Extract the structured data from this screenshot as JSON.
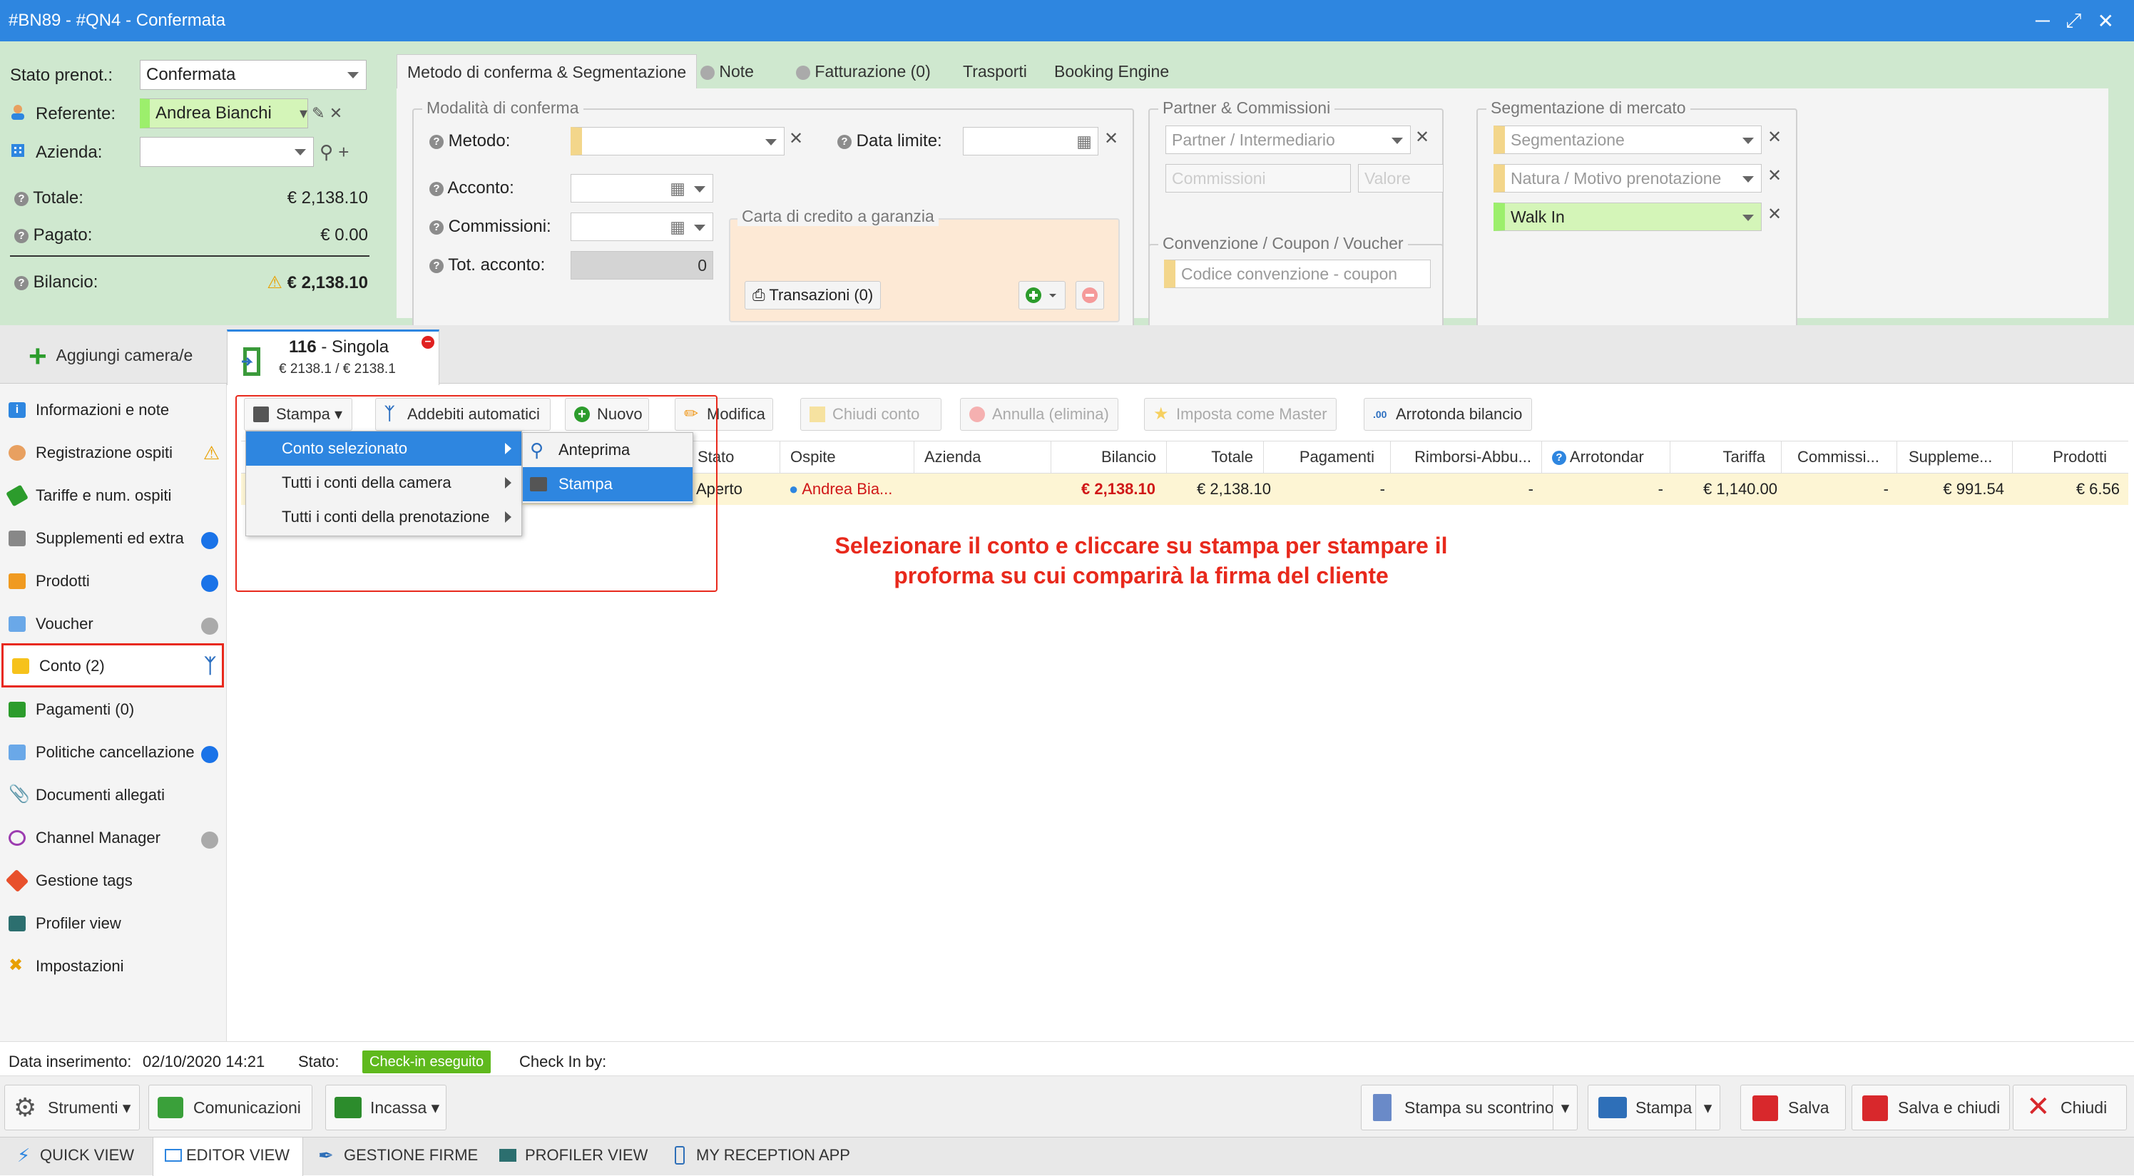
{
  "window": {
    "title": "#BN89 - #QN4 - Confermata"
  },
  "left_form": {
    "stato_label": "Stato prenot.:",
    "stato_value": "Confermata",
    "referente_label": "Referente:",
    "referente_value": "Andrea Bianchi",
    "azienda_label": "Azienda:",
    "totale_label": "Totale:",
    "totale_value": "€ 2,138.10",
    "pagato_label": "Pagato:",
    "pagato_value": "€ 0.00",
    "bilancio_label": "Bilancio:",
    "bilancio_value": "€ 2,138.10"
  },
  "top_tabs": [
    "Metodo di conferma & Segmentazione",
    "Note",
    "Fatturazione (0)",
    "Trasporti",
    "Booking Engine"
  ],
  "conferma": {
    "legend": "Modalità di conferma",
    "metodo_label": "Metodo:",
    "data_limite_label": "Data limite:",
    "acconto_label": "Acconto:",
    "commissioni_label": "Commissioni:",
    "tot_acconto_label": "Tot. acconto:",
    "tot_acconto_value": "0",
    "carta_legend": "Carta di credito a garanzia",
    "transazioni_label": "Transazioni (0)"
  },
  "partner": {
    "legend": "Partner & Commissioni",
    "partner_placeholder": "Partner / Intermediario",
    "commissioni_placeholder": "Commissioni",
    "valore_placeholder": "Valore"
  },
  "convenzione": {
    "legend": "Convenzione / Coupon / Voucher",
    "placeholder": "Codice convenzione - coupon"
  },
  "segmentazione": {
    "legend": "Segmentazione di mercato",
    "seg_placeholder": "Segmentazione",
    "natura_placeholder": "Natura / Motivo prenotazione",
    "value": "Walk In"
  },
  "add_room": "Aggiungi camera/e",
  "room_tab": {
    "number": "116",
    "type": " - Singola",
    "amount": "€ 2138.1 / € 2138.1"
  },
  "sidebar": [
    {
      "label": "Informazioni e note"
    },
    {
      "label": "Registrazione ospiti"
    },
    {
      "label": "Tariffe e num. ospiti"
    },
    {
      "label": "Supplementi ed extra"
    },
    {
      "label": "Prodotti"
    },
    {
      "label": "Voucher"
    },
    {
      "label": "Conto (2)"
    },
    {
      "label": "Pagamenti (0)"
    },
    {
      "label": "Politiche cancellazione"
    },
    {
      "label": "Documenti allegati"
    },
    {
      "label": "Channel Manager"
    },
    {
      "label": "Gestione tags"
    },
    {
      "label": "Profiler view"
    },
    {
      "label": "Impostazioni"
    }
  ],
  "toolbar": {
    "stampa": "Stampa",
    "addebiti": "Addebiti automatici",
    "nuovo": "Nuovo",
    "modifica": "Modifica",
    "chiudi": "Chiudi conto",
    "annulla": "Annulla (elimina)",
    "master": "Imposta come Master",
    "arrotonda": "Arrotonda bilancio"
  },
  "table": {
    "headers": [
      "Stato",
      "Ospite",
      "Azienda",
      "Bilancio",
      "Totale",
      "Pagamenti",
      "Rimborsi-Abbu...",
      "Arrotondar",
      "Tariffa",
      "Commissi...",
      "Suppleme...",
      "Prodotti"
    ],
    "row": [
      "Aperto",
      "Andrea Bia...",
      "",
      "€ 2,138.10",
      "€ 2,138.10",
      "-",
      "-",
      "-",
      "€ 1,140.00",
      "-",
      "€ 991.54",
      "€ 6.56"
    ]
  },
  "menu": {
    "items": [
      "Conto selezionato",
      "Tutti i conti della camera",
      "Tutti i conti della prenotazione"
    ],
    "sub": [
      "Anteprima",
      "Stampa"
    ]
  },
  "annotation": {
    "line1": "Selezionare il conto e cliccare su stampa per stampare il",
    "line2": "proforma su cui comparirà la firma del cliente"
  },
  "status": {
    "inserimento_label": "Data inserimento:",
    "inserimento_value": "02/10/2020 14:21",
    "stato_label": "Stato:",
    "stato_value": "Check-in eseguito",
    "checkin_label": "Check In by:"
  },
  "bottom": {
    "strumenti": "Strumenti",
    "comunicazioni": "Comunicazioni",
    "incassa": "Incassa",
    "scontrino": "Stampa su scontrino",
    "stampa": "Stampa",
    "salva": "Salva",
    "salva_chiudi": "Salva e chiudi",
    "chiudi": "Chiudi"
  },
  "views": [
    "QUICK VIEW",
    "EDITOR VIEW",
    "GESTIONE FIRME",
    "PROFILER VIEW",
    "MY RECEPTION APP"
  ],
  "colors": {
    "title_blue": "#2e86e0",
    "form_green": "#cfe8cf",
    "selection_blue": "#2e86e0",
    "annotation_red": "#e8291c",
    "checkin_green": "#5fb91d"
  }
}
